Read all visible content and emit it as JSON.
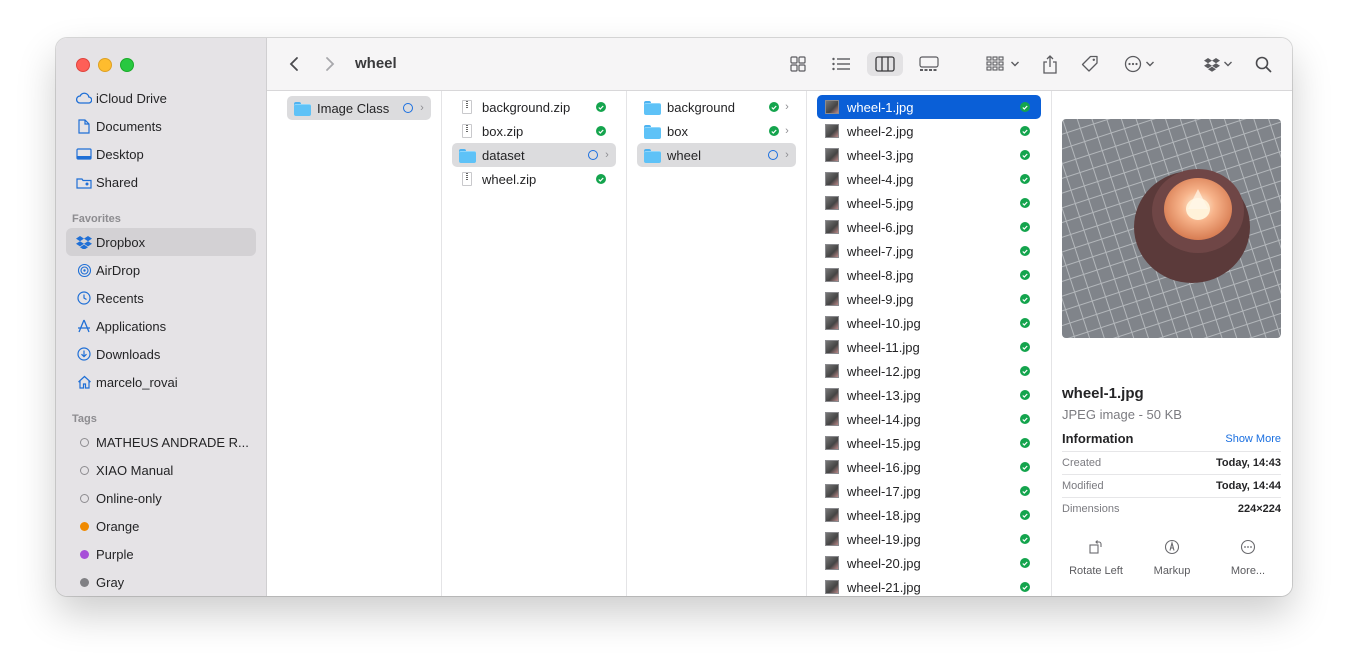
{
  "toolbar": {
    "title": "wheel"
  },
  "sidebar": {
    "locations": [
      {
        "label": "iCloud Drive",
        "icon": "cloud-icon"
      },
      {
        "label": "Documents",
        "icon": "document-icon"
      },
      {
        "label": "Desktop",
        "icon": "desktop-icon"
      },
      {
        "label": "Shared",
        "icon": "shared-folder-icon"
      }
    ],
    "favorites_header": "Favorites",
    "favorites": [
      {
        "label": "Dropbox",
        "icon": "dropbox-icon"
      },
      {
        "label": "AirDrop",
        "icon": "airdrop-icon"
      },
      {
        "label": "Recents",
        "icon": "clock-icon"
      },
      {
        "label": "Applications",
        "icon": "applications-icon"
      },
      {
        "label": "Downloads",
        "icon": "download-icon"
      },
      {
        "label": "marcelo_rovai",
        "icon": "home-icon"
      }
    ],
    "tags_header": "Tags",
    "tags": [
      {
        "label": "MATHEUS ANDRADE R...",
        "color": "ring"
      },
      {
        "label": "XIAO Manual",
        "color": "ring"
      },
      {
        "label": "Online-only",
        "color": "ring"
      },
      {
        "label": "Orange",
        "color": "#f08a00"
      },
      {
        "label": "Purple",
        "color": "#a750d8"
      },
      {
        "label": "Gray",
        "color": "#808084"
      }
    ]
  },
  "columns": {
    "col1": [
      {
        "name": "Image Class"
      }
    ],
    "col2": [
      {
        "name": "background.zip",
        "kind": "zip"
      },
      {
        "name": "box.zip",
        "kind": "zip"
      },
      {
        "name": "dataset",
        "kind": "folder"
      },
      {
        "name": "wheel.zip",
        "kind": "zip"
      }
    ],
    "col3": [
      {
        "name": "background"
      },
      {
        "name": "box"
      },
      {
        "name": "wheel"
      }
    ],
    "col4": [
      "wheel-1.jpg",
      "wheel-2.jpg",
      "wheel-3.jpg",
      "wheel-4.jpg",
      "wheel-5.jpg",
      "wheel-6.jpg",
      "wheel-7.jpg",
      "wheel-8.jpg",
      "wheel-9.jpg",
      "wheel-10.jpg",
      "wheel-11.jpg",
      "wheel-12.jpg",
      "wheel-13.jpg",
      "wheel-14.jpg",
      "wheel-15.jpg",
      "wheel-16.jpg",
      "wheel-17.jpg",
      "wheel-18.jpg",
      "wheel-19.jpg",
      "wheel-20.jpg",
      "wheel-21.jpg"
    ]
  },
  "preview": {
    "filename": "wheel-1.jpg",
    "subtitle": "JPEG image - 50 KB",
    "info_header": "Information",
    "show_more": "Show More",
    "rows": [
      {
        "key": "Created",
        "value": "Today, 14:43"
      },
      {
        "key": "Modified",
        "value": "Today, 14:44"
      },
      {
        "key": "Dimensions",
        "value": "224×224"
      }
    ],
    "actions": [
      {
        "label": "Rotate Left",
        "icon": "rotate-left-icon"
      },
      {
        "label": "Markup",
        "icon": "markup-icon"
      },
      {
        "label": "More...",
        "icon": "more-icon"
      }
    ]
  },
  "colors": {
    "accent": "#0a5fd7",
    "synced_check": "#14a44d",
    "sidebar_bg": "#e5e3e6"
  }
}
